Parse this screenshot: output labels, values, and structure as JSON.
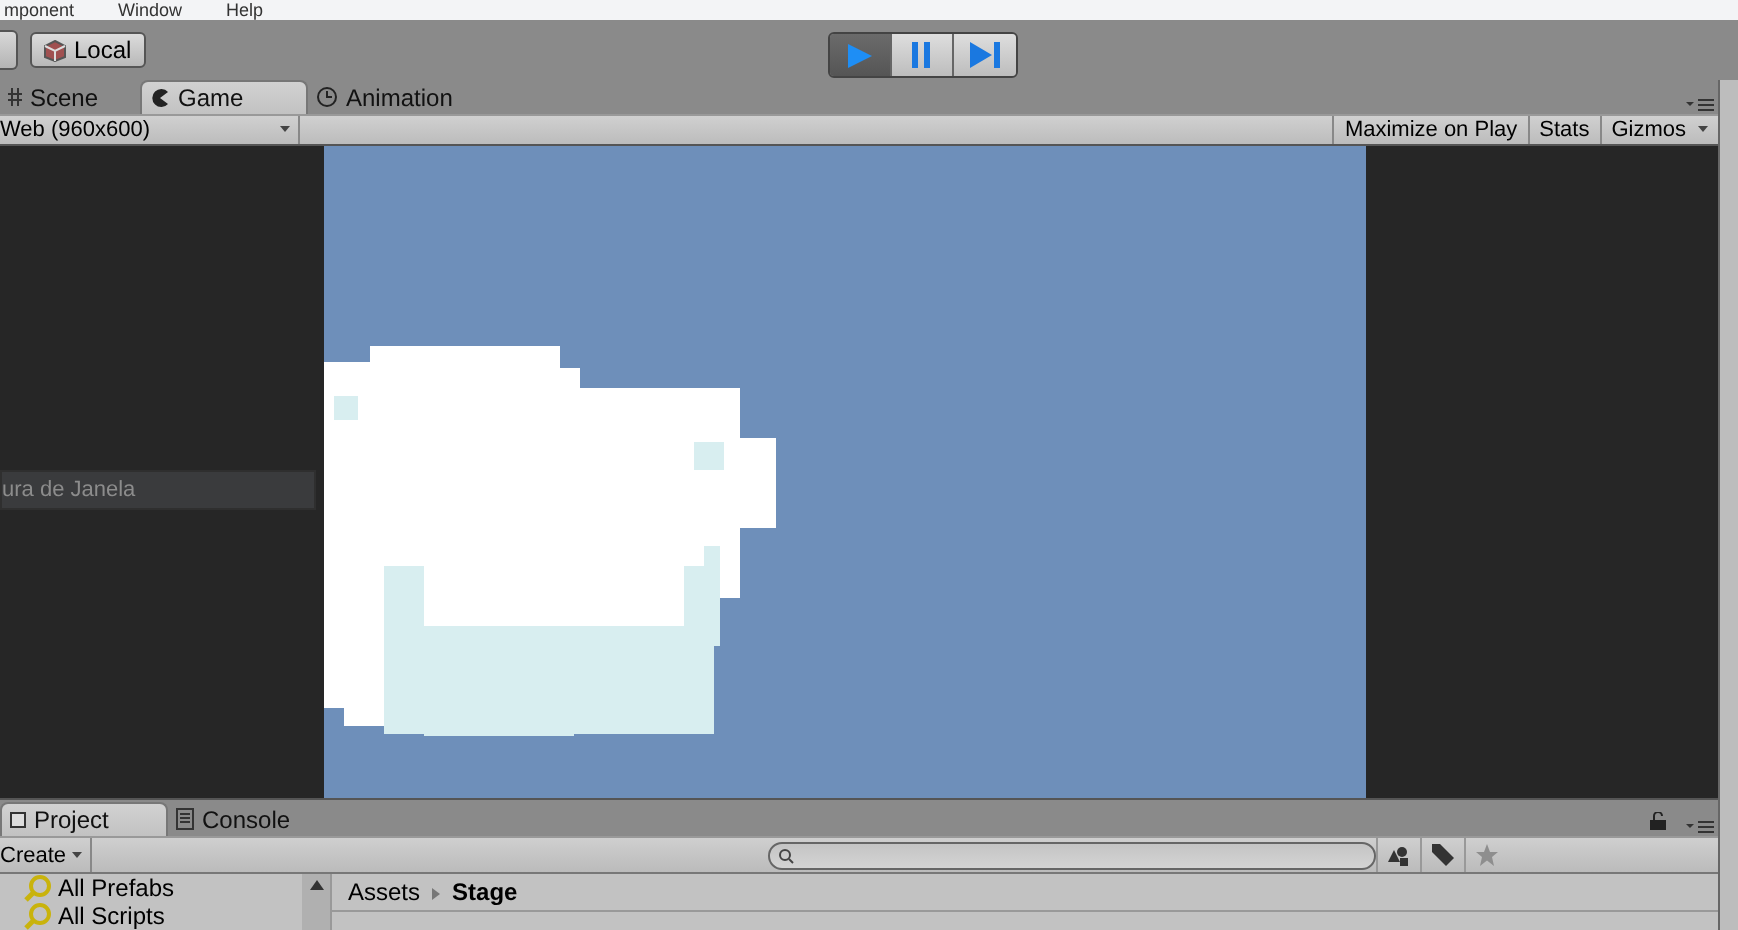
{
  "menu_bar": {
    "items": [
      "mponent",
      "Window",
      "Help"
    ]
  },
  "toolbar": {
    "pivot_button": {
      "label": "Local"
    },
    "playback": [
      {
        "kind": "play",
        "on": true
      },
      {
        "kind": "pause",
        "on": false
      },
      {
        "kind": "step",
        "on": false
      }
    ]
  },
  "view_tabs": [
    {
      "label": "Scene",
      "selected": false,
      "kind": "scene"
    },
    {
      "label": "Game",
      "selected": true,
      "kind": "game"
    },
    {
      "label": "Animation",
      "selected": false,
      "kind": "animation"
    }
  ],
  "game_toolbar": {
    "resolution": "Web (960x600)",
    "toggles": [
      {
        "label": "Maximize on Play",
        "on": false
      },
      {
        "label": "Stats",
        "on": false
      }
    ],
    "gizmos": "Gizmos"
  },
  "overlay_field": "ura de Janela",
  "project_tabs": [
    {
      "label": "Project",
      "selected": true,
      "kind": "project"
    },
    {
      "label": "Console",
      "selected": false,
      "kind": "console"
    }
  ],
  "project_toolbar": {
    "create": "Create"
  },
  "favorites": [
    "All Prefabs",
    "All Scripts"
  ],
  "breadcrumb": [
    "Assets",
    "Stage"
  ]
}
